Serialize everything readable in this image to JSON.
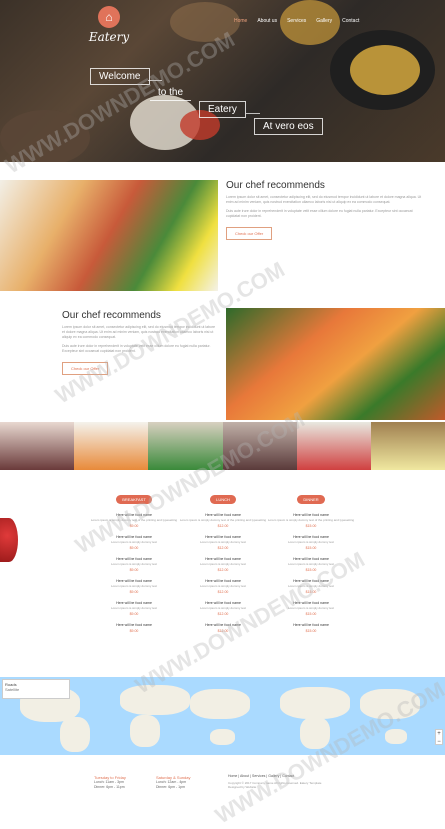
{
  "brand": {
    "name": "Eatery"
  },
  "nav": [
    "Home",
    "About us",
    "Services",
    "Gallery",
    "Contact"
  ],
  "hero": {
    "line1": "Welcome",
    "line2": "to the",
    "line3": "Eatery",
    "line4": "At vero eos"
  },
  "section1": {
    "title": "Our chef recommends",
    "text": "Lorem ipsum dolor sit amet, consectetur adipiscing elit, sed do eiusmod tempor incididunt ut labore et dolore magna aliqua. Ut enim ad minim veniam, quis nostrud exercitation ullamco laboris nisi ut aliquip ex ea commodo consequat.",
    "text2": "Duis aute irure dolor in reprehenderit in voluptate velit esse cillum dolore eu fugiat nulla pariatur. Excepteur sint occaecat cupidatat non proident.",
    "button": "Check our Offer"
  },
  "section2": {
    "title": "Our chef recommends",
    "text": "Lorem ipsum dolor sit amet, consectetur adipiscing elit, sed do eiusmod tempor incididunt ut labore et dolore magna aliqua. Ut enim ad minim veniam, quis nostrud exercitation ullamco laboris nisi ut aliquip ex ea commodo consequat.",
    "text2": "Duis aute irure dolor in reprehenderit in voluptate velit esse cillum dolore eu fugiat nulla pariatur. Excepteur sint occaecat cupidatat non proident.",
    "button": "Check our Offer"
  },
  "menu": [
    {
      "category": "BREAKFAST",
      "items": [
        {
          "title": "Here will be food name",
          "desc": "Lorem ipsum is simply dummy text of the printing and typesetting",
          "price": "$9.00"
        },
        {
          "title": "Here will be food name",
          "desc": "Lorem ipsum is simply dummy text",
          "price": "$9.00"
        },
        {
          "title": "Here will be food name",
          "desc": "Lorem ipsum is simply dummy text",
          "price": "$9.00"
        },
        {
          "title": "Here will be food name",
          "desc": "Lorem ipsum is simply dummy text",
          "price": "$9.00"
        },
        {
          "title": "Here will be food name",
          "desc": "Lorem ipsum is simply dummy text",
          "price": "$9.00"
        },
        {
          "title": "Here will be food name",
          "desc": "",
          "price": "$9.00"
        }
      ]
    },
    {
      "category": "LUNCH",
      "items": [
        {
          "title": "Here will be food name",
          "desc": "Lorem ipsum is simply dummy text of the printing and typesetting",
          "price": "$12.00"
        },
        {
          "title": "Here will be food name",
          "desc": "Lorem ipsum is simply dummy text",
          "price": "$12.00"
        },
        {
          "title": "Here will be food name",
          "desc": "Lorem ipsum is simply dummy text",
          "price": "$12.00"
        },
        {
          "title": "Here will be food name",
          "desc": "Lorem ipsum is simply dummy text",
          "price": "$12.00"
        },
        {
          "title": "Here will be food name",
          "desc": "Lorem ipsum is simply dummy text",
          "price": "$12.00"
        },
        {
          "title": "Here will be food name",
          "desc": "",
          "price": "$12.00"
        }
      ]
    },
    {
      "category": "DINNER",
      "items": [
        {
          "title": "Here will be food name",
          "desc": "Lorem ipsum is simply dummy text of the printing and typesetting",
          "price": "$15.00"
        },
        {
          "title": "Here will be food name",
          "desc": "Lorem ipsum is simply dummy text",
          "price": "$15.00"
        },
        {
          "title": "Here will be food name",
          "desc": "Lorem ipsum is simply dummy text",
          "price": "$15.00"
        },
        {
          "title": "Here will be food name",
          "desc": "Lorem ipsum is simply dummy text",
          "price": "$15.00"
        },
        {
          "title": "Here will be food name",
          "desc": "Lorem ipsum is simply dummy text",
          "price": "$15.00"
        },
        {
          "title": "Here will be food name",
          "desc": "",
          "price": "$15.00"
        }
      ]
    }
  ],
  "map": {
    "label": "Roads",
    "sublabel": "Satellite"
  },
  "footer": {
    "col1": {
      "title": "Tuesday to Friday",
      "line1": "Lunch: 11am - 3pm",
      "line2": "Dinner: 6pm - 11pm"
    },
    "col2": {
      "title": "Saturday & Sunday",
      "line1": "Lunch: 12am - 4pm",
      "line2": "Dinner: 6pm - 1pm"
    },
    "nav": "Home | About | Services | Gallery | Contact",
    "copyright": "Copyright © 2017 Company name All rights reserved. Eatery Template",
    "copyright2": "Designed by Website"
  },
  "watermark": "WWW.DOWNDEMO.COM"
}
